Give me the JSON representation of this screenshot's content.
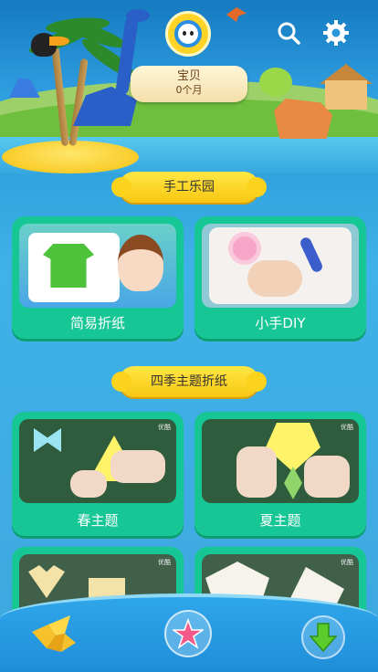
{
  "header": {
    "profile": {
      "name": "宝贝",
      "age": "0个月"
    },
    "icons": {
      "search": "search-icon",
      "settings": "gear-icon"
    }
  },
  "sections": [
    {
      "title": "手工乐园",
      "cards": [
        {
          "label": "简易折纸"
        },
        {
          "label": "小手DIY"
        }
      ]
    },
    {
      "title": "四季主题折纸",
      "cards": [
        {
          "label": "春主题",
          "tag": "优酷"
        },
        {
          "label": "夏主题",
          "tag": "优酷"
        },
        {
          "label": "",
          "tag": "优酷"
        },
        {
          "label": "",
          "tag": "优酷"
        }
      ]
    }
  ],
  "bottom_nav": {
    "items": [
      "bird-origami-icon",
      "star-icon",
      "download-arrow-icon"
    ]
  },
  "colors": {
    "pill": "#f8c712",
    "card": "#16c694",
    "background": "#3da7de"
  }
}
